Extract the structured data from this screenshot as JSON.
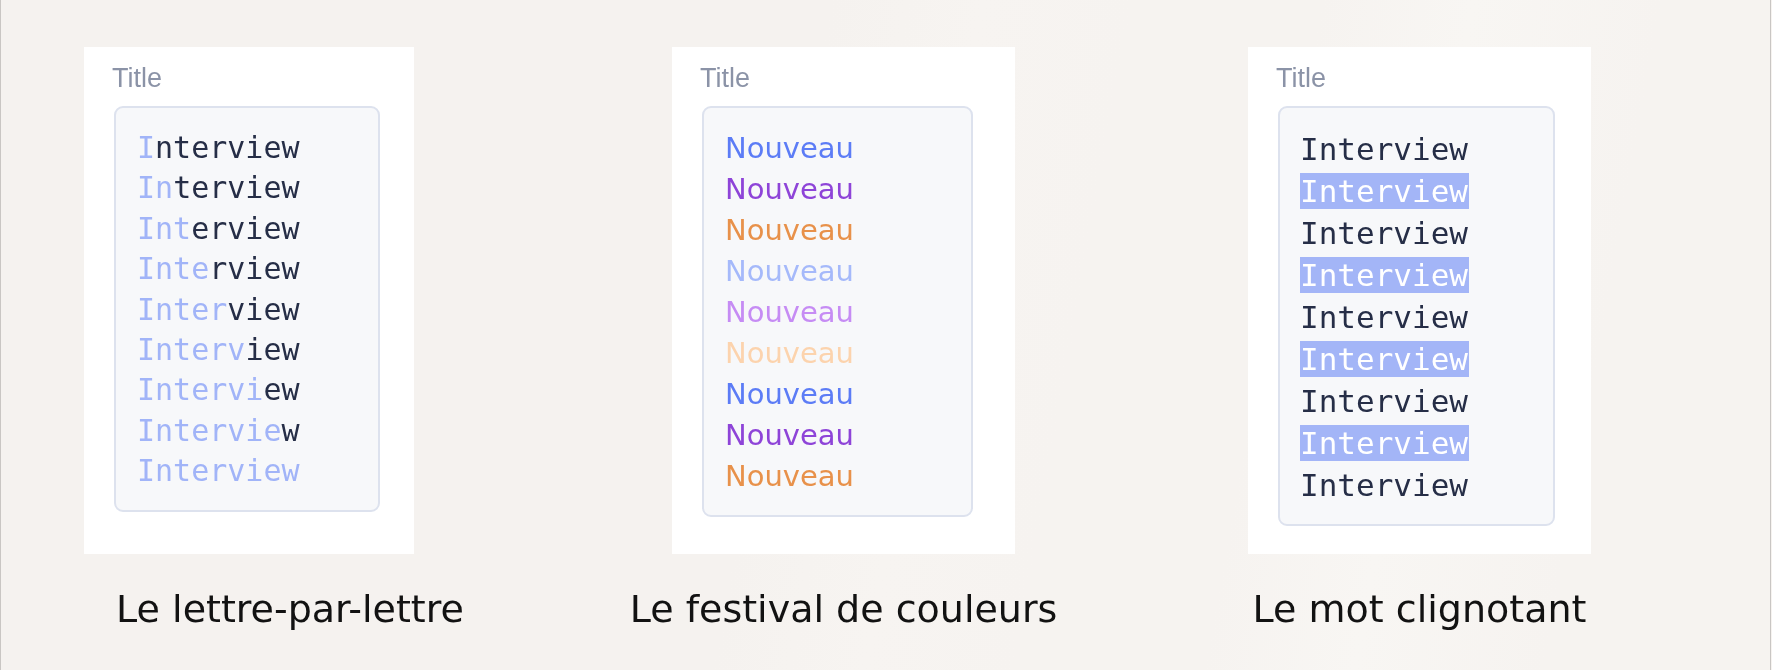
{
  "demos": [
    {
      "kind": "letter_reveal",
      "field_label": "Title",
      "lines": [
        {
          "lit": "I",
          "rest": "nterview"
        },
        {
          "lit": "In",
          "rest": "terview"
        },
        {
          "lit": "Int",
          "rest": "erview"
        },
        {
          "lit": "Inte",
          "rest": "rview"
        },
        {
          "lit": "Inter",
          "rest": "view"
        },
        {
          "lit": "Interv",
          "rest": "iew"
        },
        {
          "lit": "Intervi",
          "rest": "ew"
        },
        {
          "lit": "Intervie",
          "rest": "w"
        },
        {
          "lit": "Interview"
        }
      ],
      "caption": "Le lettre-par-lettre"
    },
    {
      "kind": "color_cycle",
      "field_label": "Title",
      "lines": [
        {
          "text": "Nouveau",
          "color": "#5c7cf6"
        },
        {
          "text": "Nouveau",
          "color": "#8e44d8"
        },
        {
          "text": "Nouveau",
          "color": "#e8914a"
        },
        {
          "text": "Nouveau",
          "color": "#a5b9fa"
        },
        {
          "text": "Nouveau",
          "color": "#c68cf4"
        },
        {
          "text": "Nouveau",
          "color": "#fcd3ad"
        },
        {
          "text": "Nouveau",
          "color": "#5c7cf6"
        },
        {
          "text": "Nouveau",
          "color": "#8e44d8"
        },
        {
          "text": "Nouveau",
          "color": "#e8914a"
        }
      ],
      "caption": "Le festival de couleurs"
    },
    {
      "kind": "highlight",
      "field_label": "Title",
      "lines": [
        {
          "text": "Interview",
          "highlighted": false
        },
        {
          "text": "Interview",
          "highlighted": true
        },
        {
          "text": "Interview",
          "highlighted": false
        },
        {
          "text": "Interview",
          "highlighted": true
        },
        {
          "text": "Interview",
          "highlighted": false
        },
        {
          "text": "Interview",
          "highlighted": true
        },
        {
          "text": "Interview",
          "highlighted": false
        },
        {
          "text": "Interview",
          "highlighted": true
        },
        {
          "text": "Interview",
          "highlighted": false
        }
      ],
      "caption": "Le mot clignotant"
    }
  ]
}
